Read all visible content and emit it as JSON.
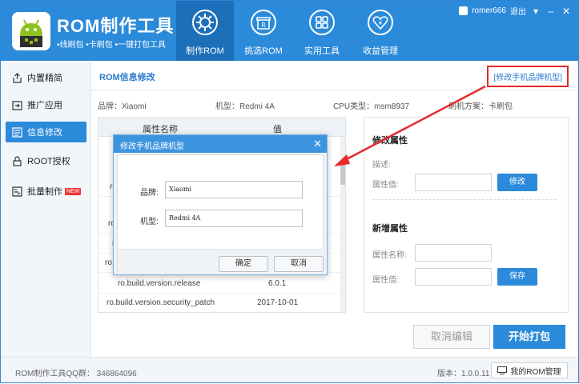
{
  "app": {
    "title": "ROM制作工具",
    "subtitle": "•线刷包  •卡刷包  •一键打包工具"
  },
  "nav": {
    "tabs": [
      {
        "label": "制作ROM",
        "icon": "gear-icon"
      },
      {
        "label": "挑选ROM",
        "icon": "shop-icon"
      },
      {
        "label": "实用工具",
        "icon": "grid-icon"
      },
      {
        "label": "收益管理",
        "icon": "heart-yen-icon"
      }
    ]
  },
  "user": {
    "name": "romer666",
    "logout": "退出"
  },
  "sidebar": {
    "items": [
      {
        "label": "内置精简",
        "icon": "upload-icon"
      },
      {
        "label": "推广应用",
        "icon": "share-icon"
      },
      {
        "label": "信息修改",
        "icon": "list-icon"
      },
      {
        "label": "ROOT授权",
        "icon": "lock-icon"
      },
      {
        "label": "批量制作",
        "icon": "batch-icon",
        "badge": "NEW"
      }
    ]
  },
  "main": {
    "title": "ROM信息修改",
    "link": "[修改手机品牌机型]",
    "info": {
      "brand": "品牌：Xiaomi",
      "model": "机型：Redmi 4A",
      "cpu": "CPU类型：msm8937",
      "scheme": "刷机方案：卡刷包"
    },
    "table": {
      "headers": [
        "属性名称",
        "值"
      ],
      "rows": [
        {
          "name": "ro",
          "value": ""
        },
        {
          "name": "ro",
          "value": ""
        },
        {
          "name": "ro",
          "value": ""
        },
        {
          "name": "ro.",
          "value": ""
        },
        {
          "name": "ro.build.version.release",
          "value": "6.0.1"
        },
        {
          "name": "ro.build.version.security_patch",
          "value": "2017-10-01"
        }
      ]
    },
    "panel": {
      "modify_title": "修改属性",
      "desc_label": "描述:",
      "value_label": "属性值:",
      "modify_btn": "修改",
      "add_title": "新增属性",
      "name_label": "属性名称:",
      "add_value_label": "属性值:",
      "save_btn": "保存"
    },
    "cancel_edit": "取消编辑",
    "start_pack": "开始打包"
  },
  "dialog": {
    "title": "修改手机品牌机型",
    "brand_label": "品牌:",
    "brand_value": "Xiaomi",
    "model_label": "机型:",
    "model_value": "Redmi 4A",
    "ok": "确定",
    "cancel": "取消"
  },
  "footer": {
    "qq": "ROM制作工具QQ群：  346864096",
    "version": "版本：1.0.0.11",
    "my_rom": "我的ROM管理"
  }
}
